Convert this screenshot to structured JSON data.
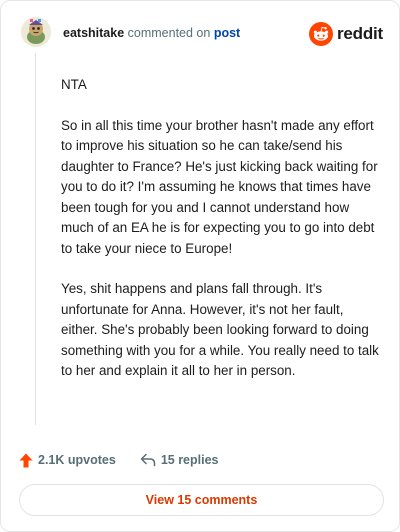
{
  "comment": {
    "username": "eatshitake",
    "action_text": "commented on",
    "post_link": "post",
    "paragraphs": [
      "NTA",
      "So in all this time your brother hasn't made any effort to improve his situation so he can take/send his daughter to France? He's just kicking back waiting for you to do it? I'm assuming he knows that times have been tough for you and I cannot understand how much of an EA he is for expecting you to go into debt to take your niece to Europe!",
      "Yes, shit happens and plans fall through. It's unfortunate for Anna. However, it's not her fault, either. She's probably been looking forward to doing something with you for a while. You really need to talk to her and explain it all to her in person."
    ]
  },
  "brand": {
    "name": "reddit",
    "color": "#ff4500"
  },
  "actions": {
    "upvotes_label": "2.1K upvotes",
    "replies_label": "15 replies"
  },
  "view_comments_label": "View 15 comments",
  "icons": {
    "upvote": "upvote-arrow-icon",
    "reply": "reply-arrow-icon",
    "logo": "reddit-alien-icon"
  }
}
